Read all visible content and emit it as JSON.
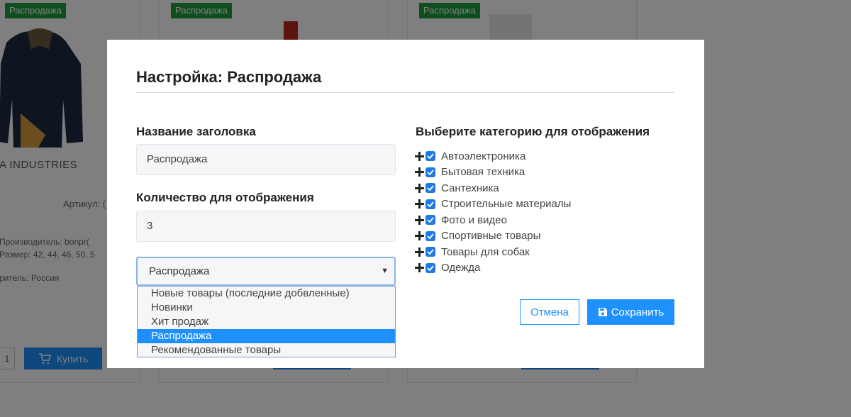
{
  "background": {
    "badge_label": "Распродажа",
    "brand": "A INDUSTRIES",
    "sku_label": "Артикул: (",
    "specs": [
      "Производитель: bonpr(",
      "Размер: 42, 44, 46, 50, 5",
      "ритель: Россия"
    ],
    "qty_value": "1",
    "buy_label": "Купить"
  },
  "modal": {
    "title": "Настройка: Распродажа",
    "heading_label": "Название заголовка",
    "heading_value": "Распродажа",
    "count_label": "Количество для отображения",
    "count_value": "3",
    "select": {
      "selected": "Распродажа",
      "options": [
        "Новые товары (последние добвленные)",
        "Новинки",
        "Хит продаж",
        "Распродажа",
        "Рекомендованные товары"
      ]
    },
    "categories_heading": "Выберите категорию для отображения",
    "categories": [
      "Автоэлектроника",
      "Бытовая техника",
      "Сантехника",
      "Строительные материалы",
      "Фото и видео",
      "Спортивные товары",
      "Товары для собак",
      "Одежда"
    ],
    "cancel_label": "Отмена",
    "save_label": "Сохранить"
  },
  "colors": {
    "accent": "#1e90ff",
    "badge": "#1f9d3a",
    "checkbox": "#1e7be0"
  }
}
